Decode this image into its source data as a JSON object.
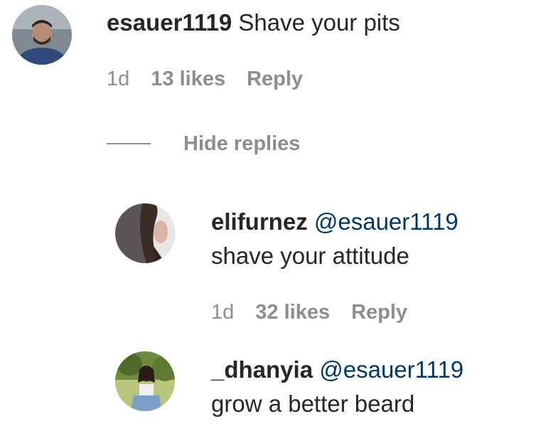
{
  "comments": [
    {
      "username": "esauer1119",
      "text": " Shave your pits",
      "time": "1d",
      "likes": "13 likes",
      "reply_label": "Reply"
    }
  ],
  "hide_replies_label": "Hide replies",
  "replies": [
    {
      "username": "elifurnez",
      "mention": "@esauer1119",
      "text": "shave your attitude",
      "time": "1d",
      "likes": "32 likes",
      "reply_label": "Reply"
    },
    {
      "username": "_dhanyia",
      "mention": "@esauer1119",
      "text": "grow a better beard"
    }
  ],
  "colors": {
    "text": "#262626",
    "muted": "#8e8e8e",
    "mention": "#00376b"
  }
}
